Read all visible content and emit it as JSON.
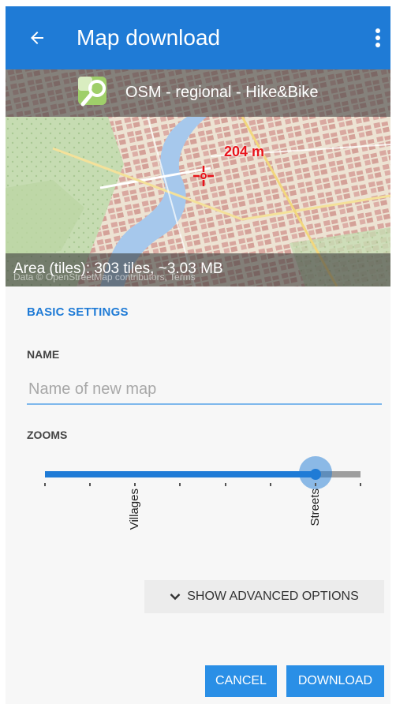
{
  "appbar": {
    "title": "Map download",
    "back_icon": "arrow-left-icon",
    "menu_icon": "more-vert-icon",
    "color": "#1f7bd6"
  },
  "map": {
    "source_label": "OSM - regional - Hike&Bike",
    "source_icon": "map-search-icon",
    "distance": "204 m",
    "area_label": "Area (tiles): 303 tiles, ~3.03 MB",
    "attribution": "Data © OpenStreetMap contributors, Terms"
  },
  "form": {
    "section_title": "BASIC SETTINGS",
    "name_label": "NAME",
    "name_placeholder": "Name of new map",
    "name_value": "",
    "zooms_label": "ZOOMS",
    "zoom_slider": {
      "tick_count": 8,
      "selected_index": 6,
      "tick_labels": [
        {
          "index": 2,
          "text": "Villages"
        },
        {
          "index": 6,
          "text": "Streets"
        }
      ]
    },
    "advanced_label": "SHOW ADVANCED OPTIONS",
    "advanced_icon": "chevron-down-icon"
  },
  "actions": {
    "cancel": "CANCEL",
    "download": "DOWNLOAD"
  }
}
